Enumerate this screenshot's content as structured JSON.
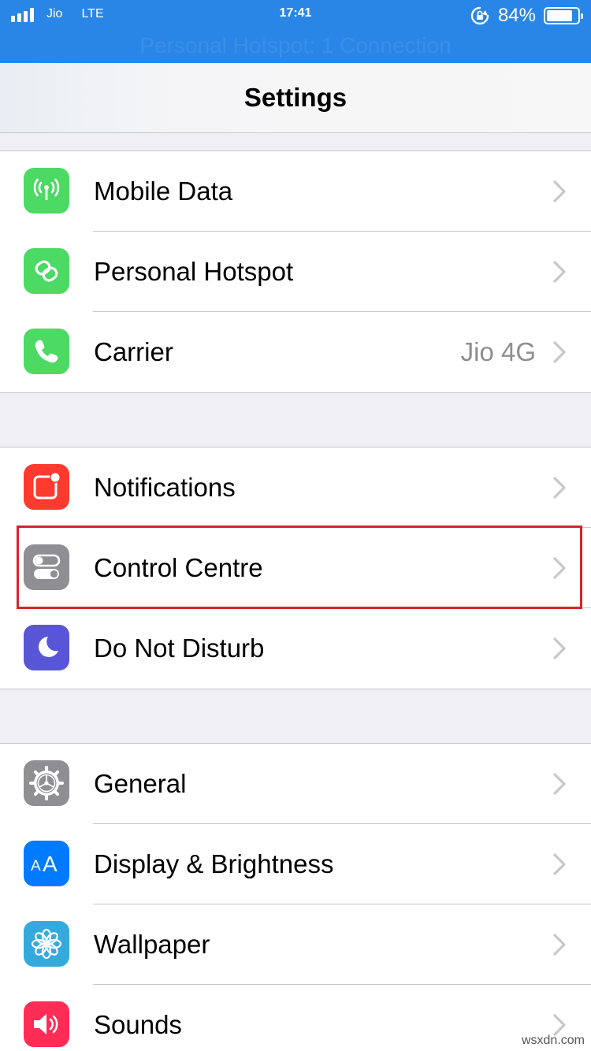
{
  "status_bar": {
    "carrier": "Jio",
    "network": "LTE",
    "time": "17:41",
    "battery_percent": "84%",
    "battery_level": 0.84,
    "banner": "Personal Hotspot: 1 Connection"
  },
  "nav": {
    "title": "Settings"
  },
  "groups": [
    {
      "items": [
        {
          "label": "Mobile Data",
          "value": "",
          "icon": "antenna-icon",
          "color": "#4cd964"
        },
        {
          "label": "Personal Hotspot",
          "value": "",
          "icon": "hotspot-link-icon",
          "color": "#4cd964"
        },
        {
          "label": "Carrier",
          "value": "Jio 4G",
          "icon": "phone-icon",
          "color": "#4cd964"
        }
      ]
    },
    {
      "items": [
        {
          "label": "Notifications",
          "value": "",
          "icon": "notifications-icon",
          "color": "#ff3b30"
        },
        {
          "label": "Control Centre",
          "value": "",
          "icon": "toggles-icon",
          "color": "#8e8e93"
        },
        {
          "label": "Do Not Disturb",
          "value": "",
          "icon": "moon-icon",
          "color": "#5856d6"
        }
      ]
    },
    {
      "items": [
        {
          "label": "General",
          "value": "",
          "icon": "gear-icon",
          "color": "#8e8e93"
        },
        {
          "label": "Display & Brightness",
          "value": "",
          "icon": "text-size-icon",
          "color": "#007aff"
        },
        {
          "label": "Wallpaper",
          "value": "",
          "icon": "flower-icon",
          "color": "#34aadc"
        },
        {
          "label": "Sounds",
          "value": "",
          "icon": "speaker-icon",
          "color": "#ff2d55"
        }
      ]
    }
  ],
  "watermark": "wsxdn.com"
}
